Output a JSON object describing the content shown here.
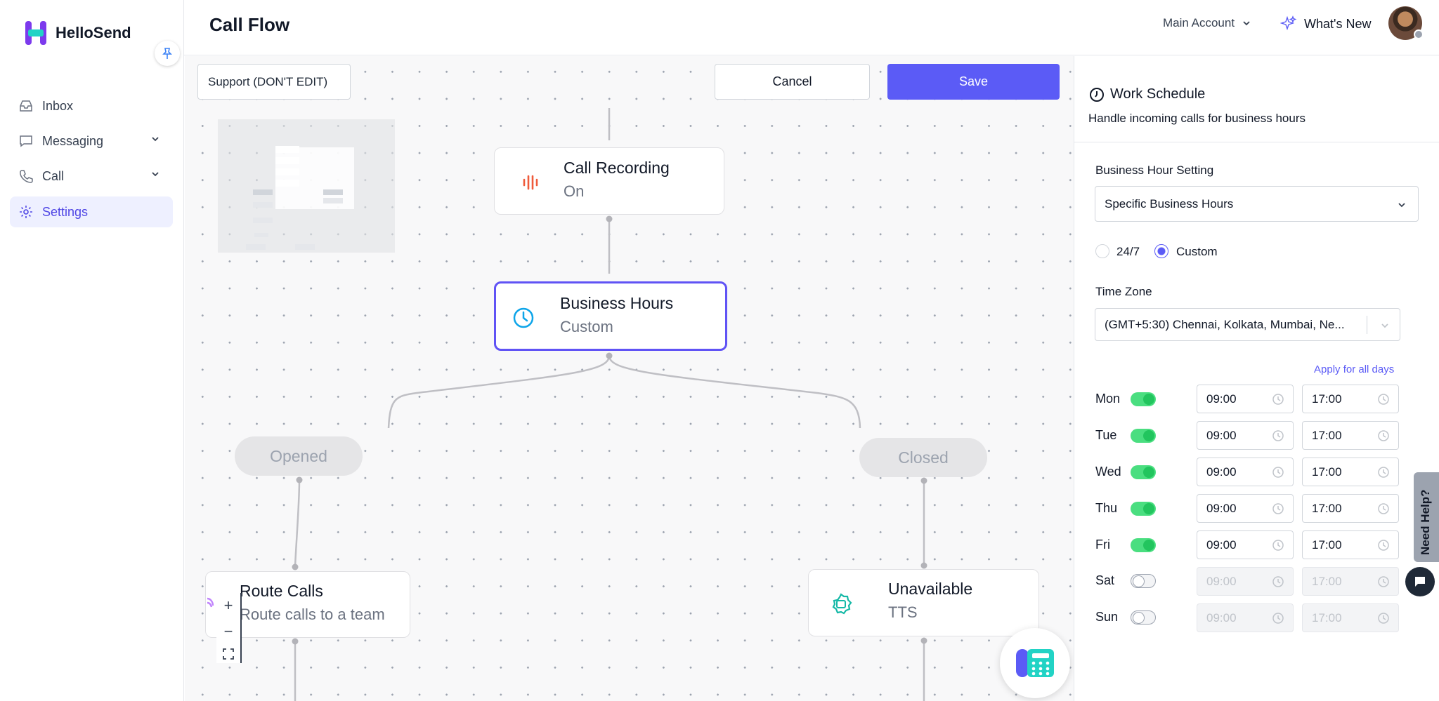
{
  "app": {
    "name": "HelloSend"
  },
  "sidebar": {
    "items": [
      {
        "label": "Inbox",
        "icon": "inbox-icon"
      },
      {
        "label": "Messaging",
        "icon": "chat-icon"
      },
      {
        "label": "Call",
        "icon": "phone-icon"
      },
      {
        "label": "Settings",
        "icon": "gear-icon"
      }
    ]
  },
  "header": {
    "title": "Call Flow",
    "account": "Main Account",
    "whats_new": "What's New"
  },
  "toolbar": {
    "flow_name": "Support (DON'T EDIT)",
    "cancel_label": "Cancel",
    "save_label": "Save"
  },
  "flow": {
    "nodes": {
      "recording": {
        "title": "Call Recording",
        "sub": "On"
      },
      "hours": {
        "title": "Business Hours",
        "sub": "Custom"
      },
      "opened": {
        "title": "Opened"
      },
      "closed": {
        "title": "Closed"
      },
      "route": {
        "title": "Route Calls",
        "sub": "Route calls to a team"
      },
      "unavailable": {
        "title": "Unavailable",
        "sub": "TTS"
      }
    }
  },
  "panel": {
    "title": "Work Schedule",
    "subtitle": "Handle incoming calls for business hours",
    "business_hour_label": "Business Hour Setting",
    "business_hour_value": "Specific Business Hours",
    "radio_247": "24/7",
    "radio_custom": "Custom",
    "selected_mode": "Custom",
    "timezone_label": "Time Zone",
    "timezone_value": "(GMT+5:30) Chennai, Kolkata, Mumbai, Ne...",
    "apply_all": "Apply for all days",
    "days": [
      {
        "day": "Mon",
        "enabled": true,
        "start": "09:00",
        "end": "17:00"
      },
      {
        "day": "Tue",
        "enabled": true,
        "start": "09:00",
        "end": "17:00"
      },
      {
        "day": "Wed",
        "enabled": true,
        "start": "09:00",
        "end": "17:00"
      },
      {
        "day": "Thu",
        "enabled": true,
        "start": "09:00",
        "end": "17:00"
      },
      {
        "day": "Fri",
        "enabled": true,
        "start": "09:00",
        "end": "17:00"
      },
      {
        "day": "Sat",
        "enabled": false,
        "start": "09:00",
        "end": "17:00"
      },
      {
        "day": "Sun",
        "enabled": false,
        "start": "09:00",
        "end": "17:00"
      }
    ]
  },
  "help": {
    "label": "Need Help?"
  },
  "colors": {
    "accent": "#5b5bf6",
    "toggle_on": "#4ade80",
    "brand": "#6d5cf5"
  }
}
